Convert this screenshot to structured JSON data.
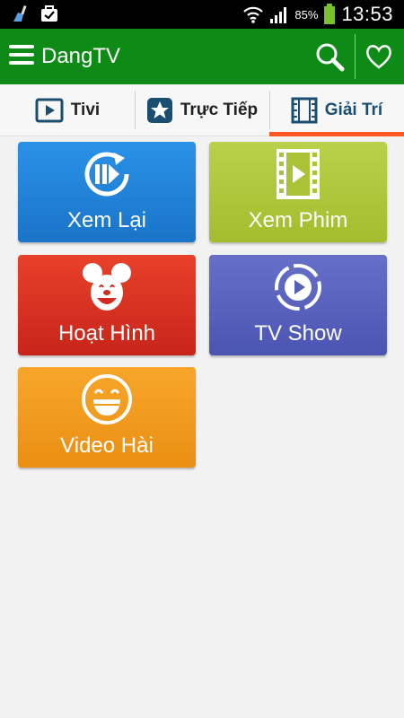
{
  "status_bar": {
    "battery_percent": "85%",
    "time": "13:53",
    "icons": [
      "cleaner-icon",
      "bag-check-icon",
      "wifi-icon",
      "signal-icon",
      "battery-icon"
    ]
  },
  "app_bar": {
    "title": "DangTV",
    "background_color": "#0e8a16",
    "icons": [
      "menu-icon",
      "search-icon",
      "heart-icon"
    ]
  },
  "tabs": [
    {
      "label": "Tivi",
      "icon": "play-box-icon",
      "selected": false
    },
    {
      "label": "Trực Tiếp",
      "icon": "star-badge-icon",
      "selected": false
    },
    {
      "label": "Giải Trí",
      "icon": "film-strip-icon",
      "selected": true
    }
  ],
  "tabs_indicator_color": "#ff5722",
  "tiles": [
    {
      "label": "Xem Lại",
      "icon": "replay-icon",
      "color": "#1a74c8"
    },
    {
      "label": "Xem Phim",
      "icon": "film-play-icon",
      "color": "#a3bd2e"
    },
    {
      "label": "Hoạt Hình",
      "icon": "mouse-cartoon-icon",
      "color": "#c8241a"
    },
    {
      "label": "TV Show",
      "icon": "play-circle-icon",
      "color": "#4b55b2"
    },
    {
      "label": "Video Hài",
      "icon": "laughing-face-icon",
      "color": "#ea8f12"
    }
  ]
}
